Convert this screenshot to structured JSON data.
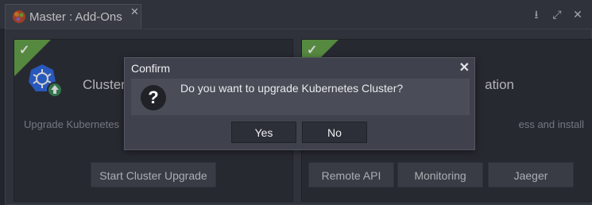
{
  "tab": {
    "label": "Master : Add-Ons",
    "close": "✕"
  },
  "window_icons": {
    "download": "⭳",
    "expand": "⤢",
    "close": "✕"
  },
  "cards": {
    "left": {
      "title": "Cluster",
      "description": "Upgrade Kubernetes",
      "button": "Start Cluster Upgrade"
    },
    "right": {
      "title": "ation",
      "description": "ess   and   install",
      "buttons": [
        "Remote API",
        "Monitoring",
        "Jaeger"
      ]
    }
  },
  "dialog": {
    "title": "Confirm",
    "message": "Do you want to upgrade Kubernetes Cluster?",
    "icon": "?",
    "yes": "Yes",
    "no": "No"
  },
  "colors": {
    "ribbon": "#6aa84f",
    "k8s": "#326ce5",
    "upgrade_badge": "#3e8e5c"
  }
}
